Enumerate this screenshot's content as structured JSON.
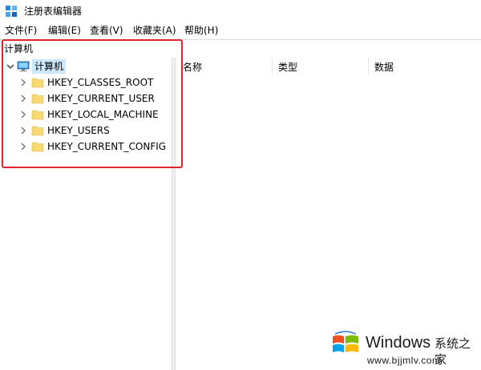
{
  "window": {
    "title": "注册表编辑器"
  },
  "menu": {
    "items": [
      {
        "label": "文件(F)"
      },
      {
        "label": "编辑(E)"
      },
      {
        "label": "查看(V)"
      },
      {
        "label": "收藏夹(A)"
      },
      {
        "label": "帮助(H)"
      }
    ]
  },
  "address": {
    "path": "计算机"
  },
  "tree": {
    "root": {
      "label": "计算机",
      "icon": "computer-icon",
      "expanded": true
    },
    "children": [
      {
        "label": "HKEY_CLASSES_ROOT",
        "icon": "folder-icon"
      },
      {
        "label": "HKEY_CURRENT_USER",
        "icon": "folder-icon"
      },
      {
        "label": "HKEY_LOCAL_MACHINE",
        "icon": "folder-icon"
      },
      {
        "label": "HKEY_USERS",
        "icon": "folder-icon"
      },
      {
        "label": "HKEY_CURRENT_CONFIG",
        "icon": "folder-icon"
      }
    ]
  },
  "list": {
    "columns": [
      {
        "label": "名称"
      },
      {
        "label": "类型"
      },
      {
        "label": "数据"
      }
    ]
  },
  "watermark": {
    "brand": "Windows",
    "site_name": "系统之家",
    "url": "www.bjjmlv.com"
  },
  "colors": {
    "highlight_border": "#e0242e",
    "folder_fill": "#f8d775",
    "selected_bg": "#cce8ff"
  }
}
